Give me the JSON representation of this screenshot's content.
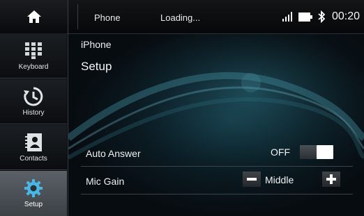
{
  "topbar": {
    "title": "Phone",
    "status": "Loading...",
    "clock": "00:20"
  },
  "sidebar": {
    "items": [
      {
        "label": "Keyboard",
        "icon": "keypad-icon"
      },
      {
        "label": "History",
        "icon": "history-icon"
      },
      {
        "label": "Contacts",
        "icon": "contacts-icon"
      },
      {
        "label": "Setup",
        "icon": "gear-icon",
        "active": true
      }
    ]
  },
  "main": {
    "breadcrumb": "iPhone",
    "title": "Setup",
    "settings": {
      "auto_answer": {
        "label": "Auto Answer",
        "value": "OFF"
      },
      "mic_gain": {
        "label": "Mic Gain",
        "value": "Middle"
      }
    }
  },
  "colors": {
    "background": "#070b0f",
    "accent_teal": "#1c4c5a",
    "active_tab": "#4c5258",
    "toggle_knob": "#ffffff"
  }
}
